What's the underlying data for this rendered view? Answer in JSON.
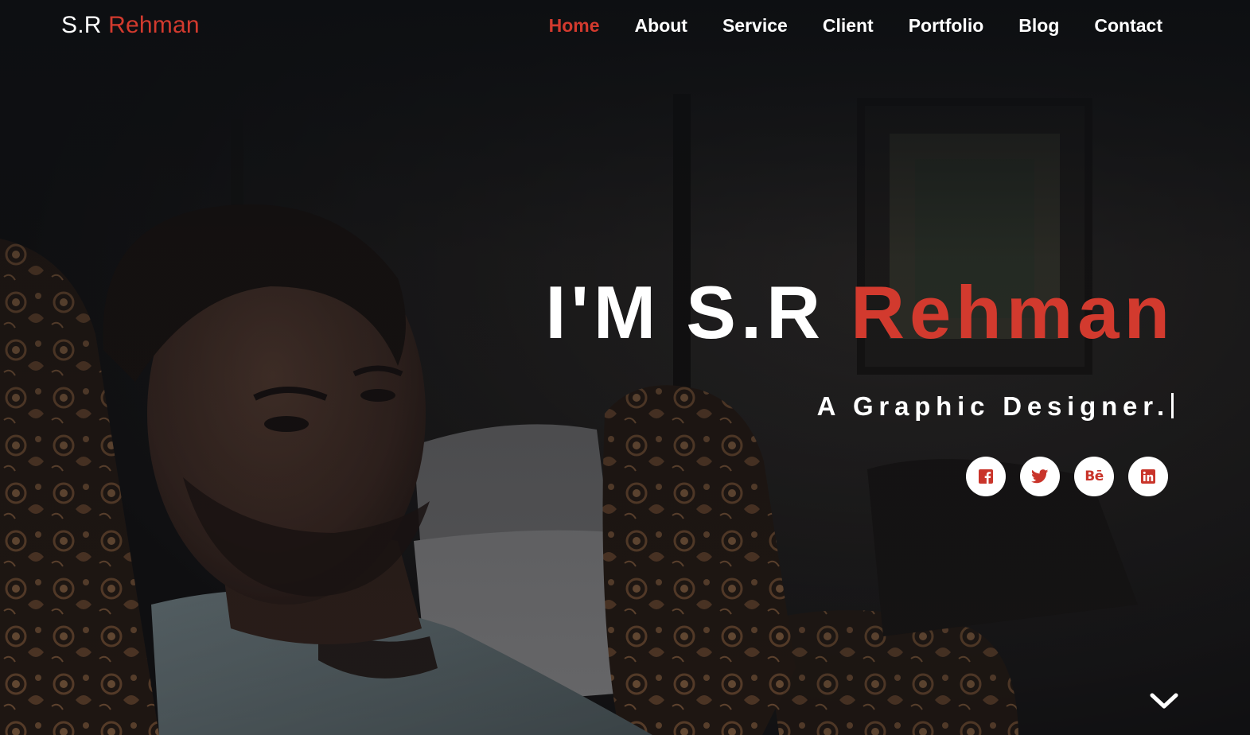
{
  "brand": {
    "first": "S.R",
    "accent": "Rehman"
  },
  "nav": {
    "items": [
      {
        "label": "Home",
        "active": true
      },
      {
        "label": "About",
        "active": false
      },
      {
        "label": "Service",
        "active": false
      },
      {
        "label": "Client",
        "active": false
      },
      {
        "label": "Portfolio",
        "active": false
      },
      {
        "label": "Blog",
        "active": false
      },
      {
        "label": "Contact",
        "active": false
      }
    ]
  },
  "hero": {
    "title_prefix": "I'M S.R",
    "title_accent": "Rehman",
    "subtitle": "A Graphic Designer."
  },
  "socials": {
    "items": [
      {
        "name": "facebook",
        "icon": "facebook-icon"
      },
      {
        "name": "twitter",
        "icon": "twitter-icon"
      },
      {
        "name": "behance",
        "icon": "behance-icon",
        "glyph": "Bē"
      },
      {
        "name": "linkedin",
        "icon": "linkedin-icon"
      }
    ]
  },
  "scroll": {
    "icon": "chevron-down-icon"
  },
  "colors": {
    "accent": "#d23a2e",
    "text": "#ffffff",
    "background": "#141416"
  }
}
